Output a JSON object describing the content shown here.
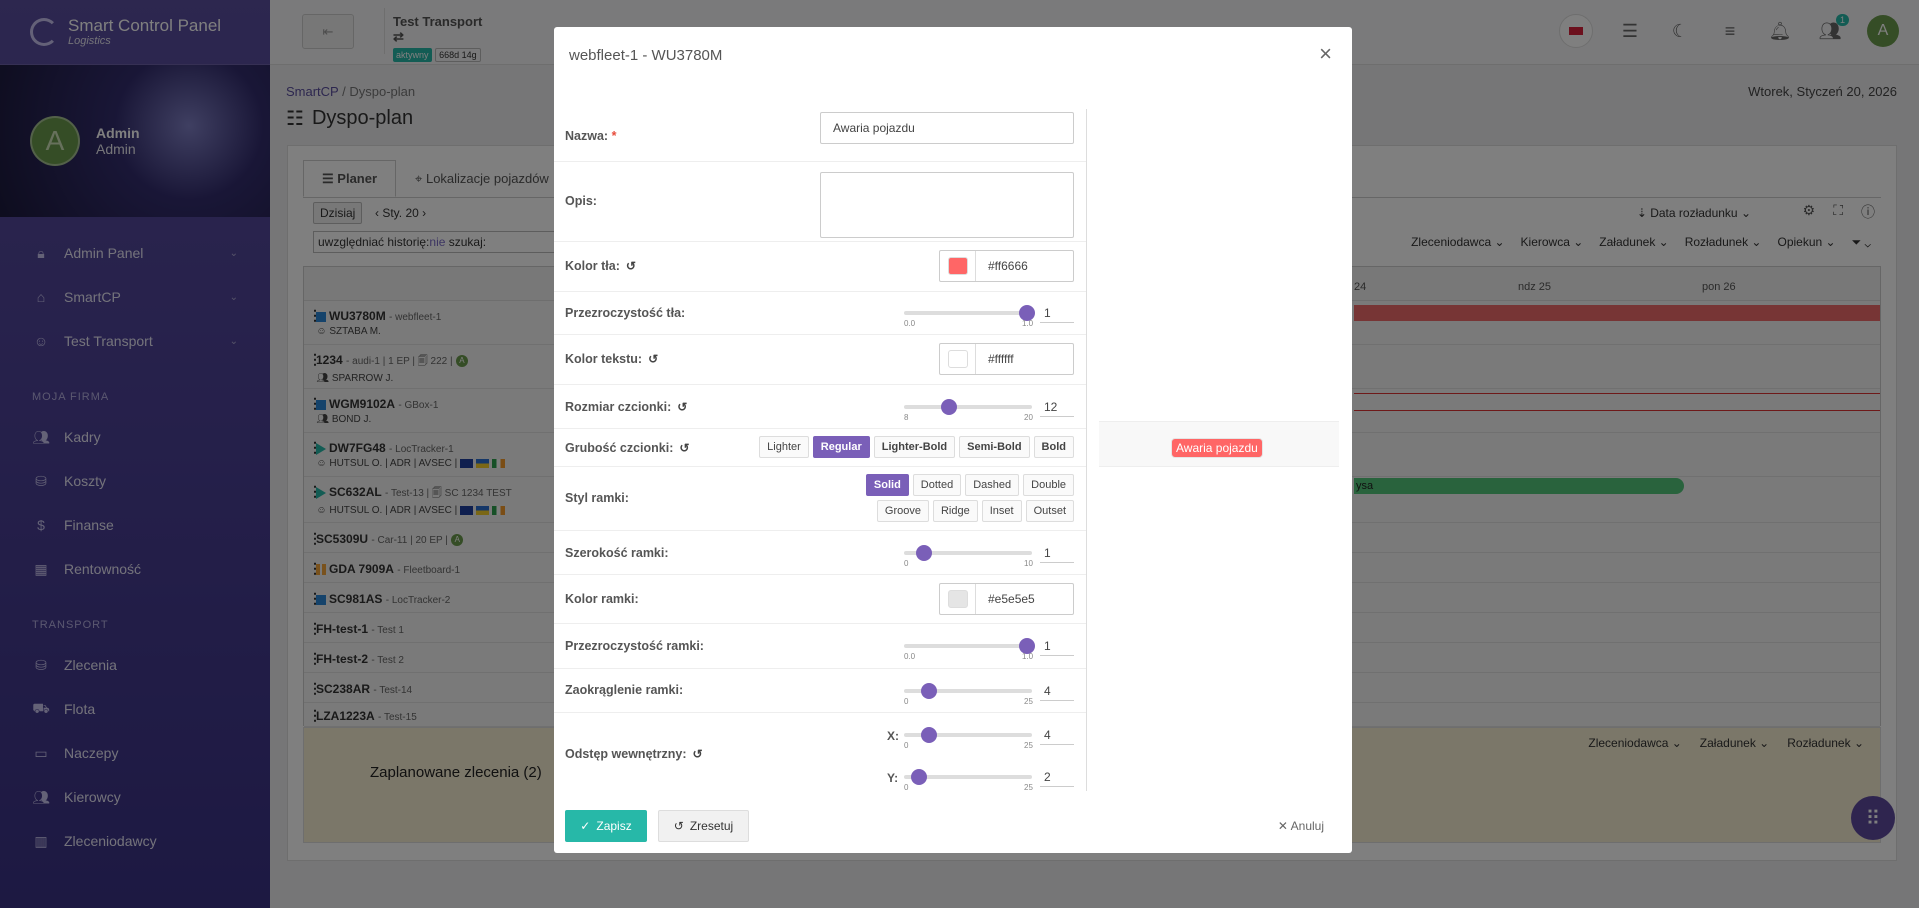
{
  "app": {
    "title": "Smart Control Panel",
    "subtitle": "Logistics"
  },
  "user": {
    "initial": "A",
    "name": "Admin",
    "role": "Admin"
  },
  "sidebar": {
    "items_top": [
      {
        "label": "Admin Panel",
        "icon": "lock-icon"
      },
      {
        "label": "SmartCP",
        "icon": "home-icon"
      },
      {
        "label": "Test Transport",
        "icon": "user-circle-icon"
      }
    ],
    "section1": "MOJA FIRMA",
    "items_firm": [
      {
        "label": "Kadry",
        "icon": "users-icon"
      },
      {
        "label": "Koszty",
        "icon": "coins-icon"
      },
      {
        "label": "Finanse",
        "icon": "dollar-icon"
      },
      {
        "label": "Rentowność",
        "icon": "chart-icon"
      }
    ],
    "section2": "TRANSPORT",
    "items_transport": [
      {
        "label": "Zlecenia",
        "icon": "coins-icon"
      },
      {
        "label": "Flota",
        "icon": "truck-icon"
      },
      {
        "label": "Naczepy",
        "icon": "trailer-icon"
      },
      {
        "label": "Kierowcy",
        "icon": "users-icon"
      },
      {
        "label": "Zleceniodawcy",
        "icon": "building-icon"
      }
    ]
  },
  "topbar": {
    "company": "Test Transport",
    "status": "aktywny",
    "days": "668d 14g",
    "notif_count": "1",
    "avatar": "A"
  },
  "breadcrumb": {
    "root": "SmartCP",
    "sep": "/",
    "current": "Dyspo-plan"
  },
  "page_title": "Dyspo-plan",
  "date_top": "Wtorek, Styczeń 20, 2026",
  "tabs": [
    "Planer",
    "Lokalizacje pojazdów"
  ],
  "toolbar": {
    "today": "Dzisiaj",
    "date": "Sty. 20",
    "sort": "Data rozładunku"
  },
  "search": {
    "prefix": "uwzględniać historię:",
    "highlight": "nie",
    "suffix": " szukaj:"
  },
  "filters": [
    "Zleceniodawca",
    "Kierowca",
    "Załadunek",
    "Rozładunek",
    "Opiekun"
  ],
  "days": [
    "24",
    "ndz 25",
    "pon 26"
  ],
  "vehicles": [
    {
      "plate": "WU3780M",
      "device": "webfleet-1",
      "line2": "SZTABA M."
    },
    {
      "plate": "1234",
      "device": "audi-1 | 1 EP | 🗐 222 |",
      "line2": "SPARROW J."
    },
    {
      "plate": "WGM9102A",
      "device": "GBox-1",
      "line2": "BOND J."
    },
    {
      "plate": "DW7FG48",
      "device": "LocTracker-1",
      "line2": "HUTSUL O. | ADR | AVSEC |"
    },
    {
      "plate": "SC632AL",
      "device": "Test-13 | 🗐 SC 1234 TEST",
      "line2": "HUTSUL O. | ADR | AVSEC |"
    },
    {
      "plate": "SC5309U",
      "device": "Car-11 | 20 EP |",
      "line2": ""
    },
    {
      "plate": "GDA 7909A",
      "device": "Fleetboard-1",
      "line2": ""
    },
    {
      "plate": "SC981AS",
      "device": "LocTracker-2",
      "line2": ""
    },
    {
      "plate": "FH-test-1",
      "device": "Test 1",
      "line2": ""
    },
    {
      "plate": "FH-test-2",
      "device": "Test 2",
      "line2": ""
    },
    {
      "plate": "SC238AR",
      "device": "Test-14",
      "line2": ""
    },
    {
      "plate": "LZA1223A",
      "device": "Test-15",
      "line2": ""
    }
  ],
  "timeline_bar_label": "ysa",
  "bottom": {
    "planned": "Zaplanowane zlecenia (2)",
    "filters": [
      "Zleceniodawca",
      "Załadunek",
      "Rozładunek"
    ]
  },
  "modal": {
    "title": "webfleet-1 - WU3780M",
    "name_label": "Nazwa:",
    "name_value": "Awaria pojazdu",
    "desc_label": "Opis:",
    "bg_color_label": "Kolor tła:",
    "bg_color": "#ff6666",
    "bg_opacity_label": "Przezroczystość tła:",
    "bg_opacity": "1",
    "text_color_label": "Kolor tekstu:",
    "text_color": "#ffffff",
    "font_size_label": "Rozmiar czcionki:",
    "font_size": "12",
    "font_size_min": "8",
    "font_size_max": "20",
    "font_weight_label": "Grubość czcionki:",
    "font_weights": [
      "Lighter",
      "Regular",
      "Lighter-Bold",
      "Semi-Bold",
      "Bold"
    ],
    "border_style_label": "Styl ramki:",
    "border_styles_row1": [
      "Solid",
      "Dotted",
      "Dashed",
      "Double"
    ],
    "border_styles_row2": [
      "Groove",
      "Ridge",
      "Inset",
      "Outset"
    ],
    "border_width_label": "Szerokość ramki:",
    "border_width": "1",
    "border_color_label": "Kolor ramki:",
    "border_color": "#e5e5e5",
    "border_opacity_label": "Przezroczystość ramki:",
    "border_opacity": "1",
    "radius_label": "Zaokrąglenie ramki:",
    "radius": "4",
    "padding_label": "Odstęp wewnętrzny:",
    "pad_x_label": "X:",
    "pad_x": "4",
    "pad_y_label": "Y:",
    "pad_y": "2",
    "tick_00": "0.0",
    "tick_10": "1.0",
    "tick_0": "0",
    "tick_10i": "10",
    "tick_25": "25",
    "preview_text": "Awaria pojazdu",
    "save": "Zapisz",
    "reset": "Zresetuj",
    "cancel": "Anuluj"
  }
}
